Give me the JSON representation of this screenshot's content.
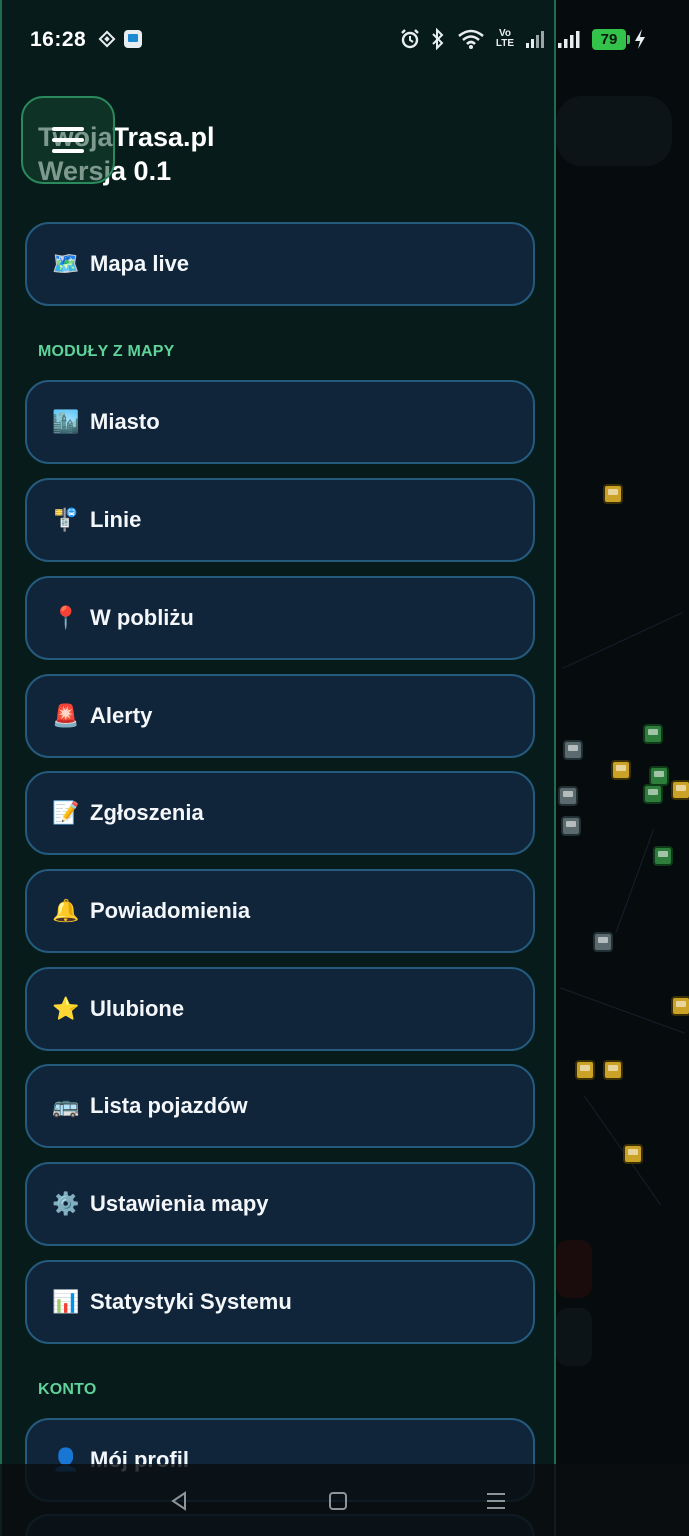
{
  "status_bar": {
    "time": "16:28",
    "battery_level": "79",
    "network_label": "Vo LTE"
  },
  "header": {
    "title": "TwojaTrasa.pl",
    "version": "Wersja 0.1"
  },
  "menu": {
    "primary": [
      {
        "emoji": "🗺️",
        "label": "Mapa live"
      }
    ],
    "section_map_modules": "MODUŁY Z MAPY",
    "map_modules": [
      {
        "emoji": "🏙️",
        "label": "Miasto"
      },
      {
        "emoji": "🚏",
        "label": "Linie"
      },
      {
        "emoji": "📍",
        "label": "W pobliżu"
      },
      {
        "emoji": "🚨",
        "label": "Alerty"
      },
      {
        "emoji": "📝",
        "label": "Zgłoszenia"
      },
      {
        "emoji": "🔔",
        "label": "Powiadomienia"
      },
      {
        "emoji": "⭐",
        "label": "Ulubione"
      },
      {
        "emoji": "🚌",
        "label": "Lista pojazdów"
      },
      {
        "emoji": "⚙️",
        "label": "Ustawienia mapy"
      },
      {
        "emoji": "📊",
        "label": "Statystyki Systemu"
      }
    ],
    "section_account": "KONTO",
    "account": [
      {
        "emoji": "👤",
        "label": "Mój profil"
      }
    ]
  },
  "colors": {
    "drawer_bg": "#071b1a",
    "item_bg": "#10243a",
    "item_border": "#245a7c",
    "section_header": "#5fd39a",
    "accent_border": "#1e6b4f",
    "battery": "#33c24a"
  }
}
